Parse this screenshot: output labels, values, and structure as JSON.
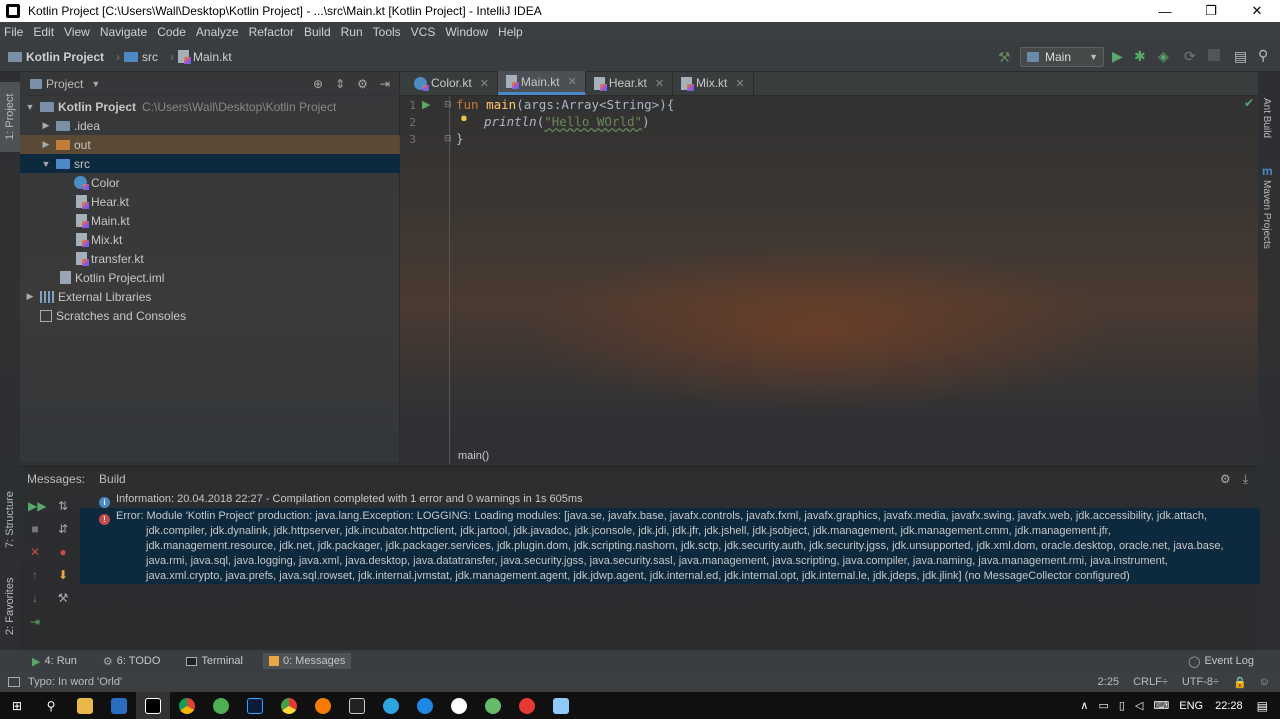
{
  "window": {
    "title": "Kotlin Project [C:\\Users\\Wall\\Desktop\\Kotlin Project] - ...\\src\\Main.kt [Kotlin Project] - IntelliJ IDEA",
    "minimize": "—",
    "maximize": "❐",
    "close": "✕"
  },
  "menu": [
    "File",
    "Edit",
    "View",
    "Navigate",
    "Code",
    "Analyze",
    "Refactor",
    "Build",
    "Run",
    "Tools",
    "VCS",
    "Window",
    "Help"
  ],
  "breadcrumbs": [
    "Kotlin Project",
    "src",
    "Main.kt"
  ],
  "run_config": "Main",
  "left_strip": {
    "project_tab": "1: Project",
    "structure_tab": "7: Structure",
    "favorites_tab": "2: Favorites"
  },
  "right_strip": {
    "ant": "Ant Build",
    "maven": "Maven Projects"
  },
  "project_panel": {
    "title": "Project",
    "root": {
      "name": "Kotlin Project",
      "path": "C:\\Users\\Wall\\Desktop\\Kotlin Project"
    },
    "items": [
      ".idea",
      "out",
      "src",
      "Color",
      "Hear.kt",
      "Main.kt",
      "Mix.kt",
      "transfer.kt",
      "Kotlin Project.iml",
      "External Libraries",
      "Scratches and Consoles"
    ]
  },
  "tabs": [
    "Color.kt",
    "Main.kt",
    "Hear.kt",
    "Mix.kt"
  ],
  "editor": {
    "line_numbers": [
      "1",
      "2",
      "3"
    ],
    "code": {
      "kw_fun": "fun ",
      "fn_name": "main",
      "params": "(args:Array<String>){",
      "call": "println",
      "open": "(",
      "string": "\"Hello WOrld\"",
      "close": ")",
      "brace": "}"
    },
    "breadcrumb": "main()"
  },
  "messages": {
    "label": "Messages:",
    "tab": "Build",
    "info": "Information: 20.04.2018 22:27 - Compilation completed with 1 error and 0 warnings in 1s 605ms",
    "error_lines": [
      "Error: Module 'Kotlin Project' production: java.lang.Exception: LOGGING: Loading modules: [java.se, javafx.base, javafx.controls, javafx.fxml, javafx.graphics, javafx.media, javafx.swing, javafx.web, jdk.accessibility, jdk.attach,",
      "jdk.compiler, jdk.dynalink, jdk.httpserver, jdk.incubator.httpclient, jdk.jartool, jdk.javadoc, jdk.jconsole, jdk.jdi, jdk.jfr, jdk.jshell, jdk.jsobject, jdk.management, jdk.management.cmm, jdk.management.jfr,",
      "jdk.management.resource, jdk.net, jdk.packager, jdk.packager.services, jdk.plugin.dom, jdk.scripting.nashorn, jdk.sctp, jdk.security.auth, jdk.security.jgss, jdk.unsupported, jdk.xml.dom, oracle.desktop, oracle.net, java.base,",
      "java.rmi, java.sql, java.logging, java.xml, java.desktop, java.datatransfer, java.security.jgss, java.security.sasl, java.management, java.scripting, java.compiler, java.naming, java.management.rmi, java.instrument,",
      "java.xml.crypto, java.prefs, java.sql.rowset, jdk.internal.jvmstat, jdk.management.agent, jdk.jdwp.agent, jdk.internal.ed, jdk.internal.opt, jdk.internal.le, jdk.jdeps, jdk.jlink] (no MessageCollector configured)"
    ]
  },
  "tool_windows": [
    "4: Run",
    "6: TODO",
    "Terminal",
    "0: Messages"
  ],
  "event_log": "Event Log",
  "status": {
    "message": "Typo: In word 'Orld'",
    "position": "2:25",
    "line_sep": "CRLF÷",
    "encoding": "UTF-8÷"
  },
  "taskbar": {
    "lang": "ENG",
    "time": "22:28"
  }
}
